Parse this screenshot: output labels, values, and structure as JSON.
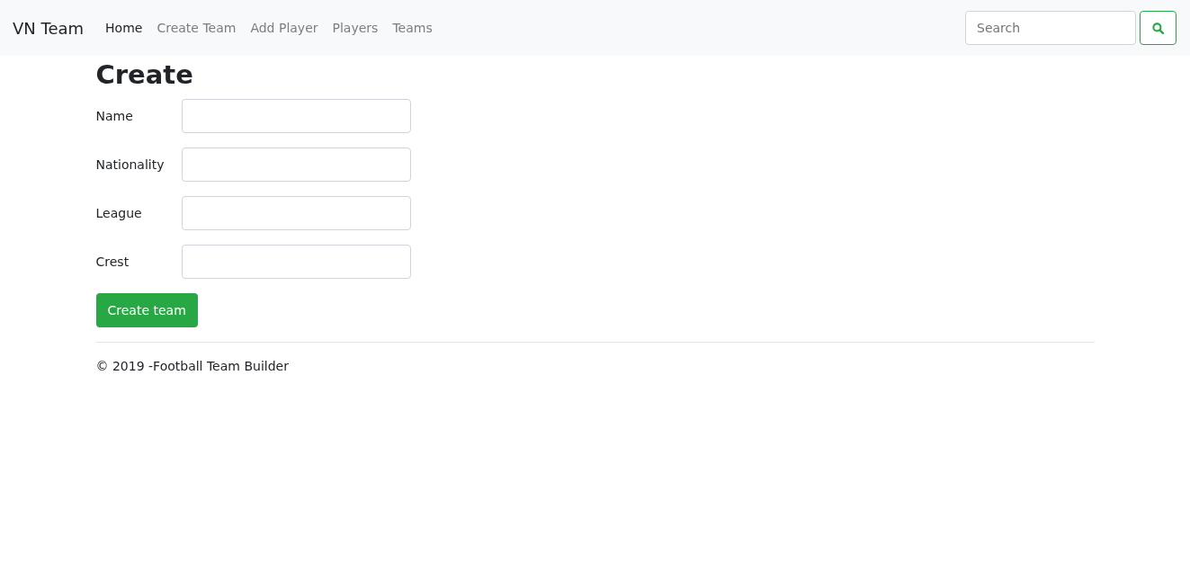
{
  "navbar": {
    "brand": "VN Team",
    "links": [
      {
        "label": "Home",
        "selected": true
      },
      {
        "label": "Create Team",
        "selected": false
      },
      {
        "label": "Add Player",
        "selected": false
      },
      {
        "label": "Players",
        "selected": false
      },
      {
        "label": "Teams",
        "selected": false
      }
    ],
    "search": {
      "placeholder": "Search"
    }
  },
  "heading": "Create",
  "form": {
    "fields": [
      {
        "label": "Name"
      },
      {
        "label": "Nationality"
      },
      {
        "label": "League"
      },
      {
        "label": "Crest"
      }
    ],
    "submit": "Create team"
  },
  "footer": "© 2019 -Football Team Builder"
}
